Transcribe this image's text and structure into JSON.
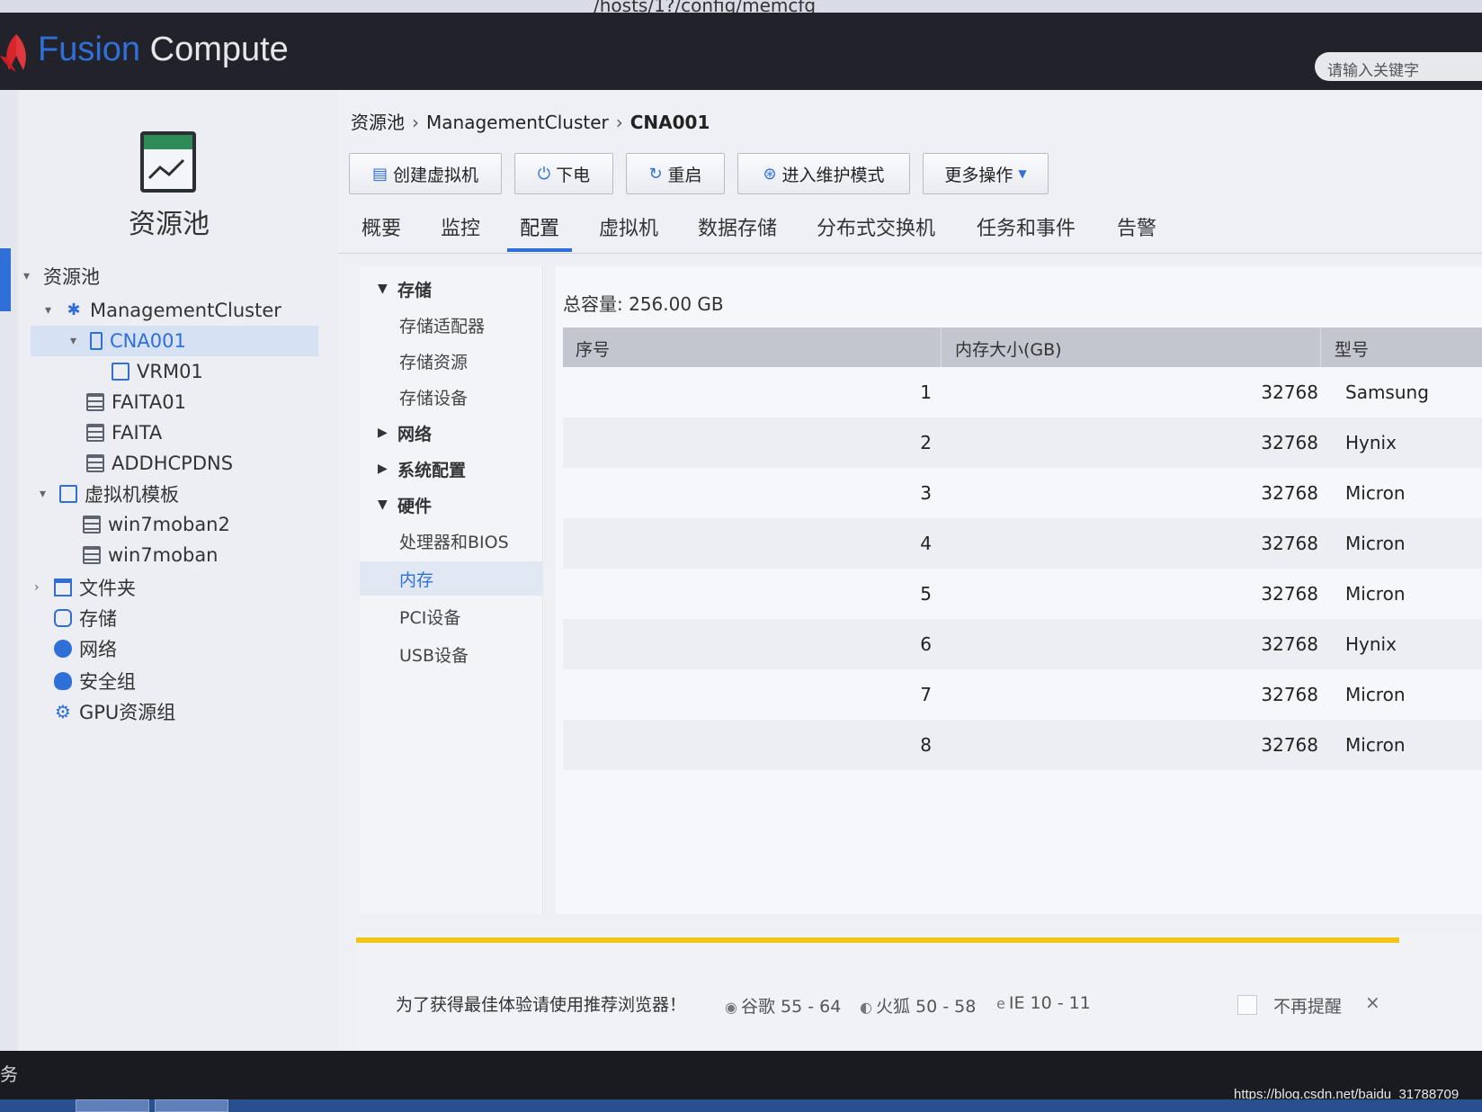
{
  "browser": {
    "url_fragment": "/hosts/1?/config/memcfg"
  },
  "app": {
    "brand_part1": "Fusion",
    "brand_part2": " Compute",
    "search_placeholder": "请输入关键字"
  },
  "left_panel": {
    "title": "资源池",
    "tree": [
      {
        "label": "资源池",
        "icon": "caret-only",
        "expanded": true
      },
      {
        "label": "ManagementCluster",
        "icon": "cluster-icon",
        "expanded": true
      },
      {
        "label": "CNA001",
        "icon": "host-icon",
        "expanded": true,
        "selected": true
      },
      {
        "label": "VRM01",
        "icon": "vm-icon"
      },
      {
        "label": "FAITA01",
        "icon": "vm-icon"
      },
      {
        "label": "FAITA",
        "icon": "vm-icon"
      },
      {
        "label": "ADDHCPDNS",
        "icon": "vm-icon"
      },
      {
        "label": "虚拟机模板",
        "icon": "template-icon",
        "expanded": true
      },
      {
        "label": "win7moban2",
        "icon": "template-item-icon"
      },
      {
        "label": "win7moban",
        "icon": "template-item-icon"
      },
      {
        "label": "文件夹",
        "icon": "folder-icon",
        "expanded": false
      },
      {
        "label": "存储",
        "icon": "storage-icon"
      },
      {
        "label": "网络",
        "icon": "network-icon"
      },
      {
        "label": "安全组",
        "icon": "security-group-icon"
      },
      {
        "label": "GPU资源组",
        "icon": "gpu-icon"
      }
    ]
  },
  "main": {
    "breadcrumb": {
      "root": "资源池",
      "cluster": "ManagementCluster",
      "current": "CNA001"
    },
    "toolbar": {
      "create_vm": "创建虚拟机",
      "power_off": "下电",
      "restart": "重启",
      "maintenance": "进入维护模式",
      "more": "更多操作"
    },
    "tabs": [
      "概要",
      "监控",
      "配置",
      "虚拟机",
      "数据存储",
      "分布式交换机",
      "任务和事件",
      "告警"
    ],
    "active_tab": "配置",
    "subnav": {
      "storage": "存储",
      "storage_adapter": "存储适配器",
      "storage_resource": "存储资源",
      "storage_device": "存储设备",
      "network": "网络",
      "system_config": "系统配置",
      "hardware": "硬件",
      "cpu_bios": "处理器和BIOS",
      "memory": "内存",
      "pci": "PCI设备",
      "usb": "USB设备"
    },
    "memory": {
      "total_label": "总容量: 256.00 GB",
      "columns": [
        "序号",
        "内存大小(GB)",
        "型号"
      ],
      "rows": [
        {
          "index": "1",
          "size": "32768",
          "model": "Samsung"
        },
        {
          "index": "2",
          "size": "32768",
          "model": "Hynix"
        },
        {
          "index": "3",
          "size": "32768",
          "model": "Micron"
        },
        {
          "index": "4",
          "size": "32768",
          "model": "Micron"
        },
        {
          "index": "5",
          "size": "32768",
          "model": "Micron"
        },
        {
          "index": "6",
          "size": "32768",
          "model": "Hynix"
        },
        {
          "index": "7",
          "size": "32768",
          "model": "Micron"
        },
        {
          "index": "8",
          "size": "32768",
          "model": "Micron"
        }
      ]
    },
    "browser_notice": {
      "message": "为了获得最佳体验请使用推荐浏览器！",
      "chrome": "谷歌 55 - 64",
      "firefox": "火狐 50 - 58",
      "ie": "IE 10 - 11",
      "dont_remind": "不再提醒",
      "close": "×"
    }
  },
  "taskbar": {
    "left_char": "务"
  },
  "watermark": "https://blog.csdn.net/baidu_31788709"
}
